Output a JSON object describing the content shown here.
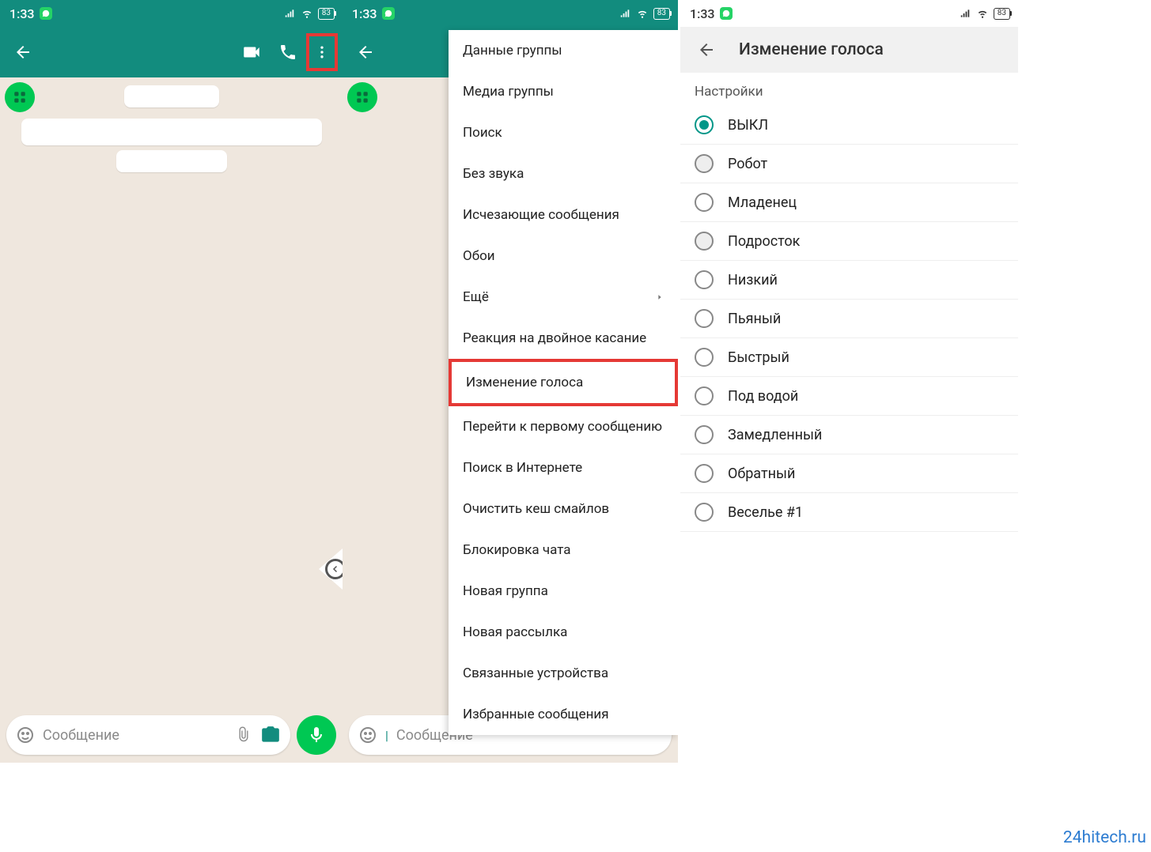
{
  "status": {
    "time": "1:33",
    "battery": "83"
  },
  "chat": {
    "placeholder": "Сообщение"
  },
  "menu": {
    "items": [
      "Данные группы",
      "Медиа группы",
      "Поиск",
      "Без звука",
      "Исчезающие сообщения",
      "Обои",
      "Ещё",
      "Реакция на двойное касание",
      "Изменение голоса",
      "Перейти к первому сообщению",
      "Поиск в Интернете",
      "Очистить кеш смайлов",
      "Блокировка чата",
      "Новая группа",
      "Новая рассылка",
      "Связанные устройства",
      "Избранные сообщения"
    ],
    "submenu_index": 6,
    "highlight_index": 8
  },
  "voice": {
    "header": "Изменение голоса",
    "section": "Настройки",
    "options": [
      {
        "label": "ВЫКЛ",
        "selected": true
      },
      {
        "label": "Робот",
        "shaded": true
      },
      {
        "label": "Младенец"
      },
      {
        "label": "Подросток",
        "shaded": true
      },
      {
        "label": "Низкий"
      },
      {
        "label": "Пьяный"
      },
      {
        "label": "Быстрый"
      },
      {
        "label": "Под водой"
      },
      {
        "label": "Замедленный"
      },
      {
        "label": "Обратный"
      },
      {
        "label": "Веселье #1"
      }
    ]
  },
  "watermark": "24hitech.ru"
}
